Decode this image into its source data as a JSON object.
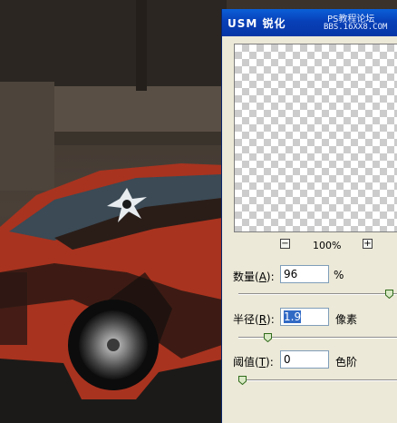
{
  "dialog": {
    "title": "USM 锐化",
    "watermark": {
      "line1": "PS教程论坛",
      "line2": "BBS.16XX8.COM"
    },
    "zoom": {
      "minus_label": "−",
      "plus_label": "+",
      "value": "100%"
    },
    "amount": {
      "label": "数量(",
      "mnemonic": "A",
      "label_end": "):",
      "value": "96",
      "unit": "%",
      "slider_fraction": 0.97
    },
    "radius": {
      "label": "半径(",
      "mnemonic": "R",
      "label_end": "):",
      "value": "1.9",
      "unit": "像素",
      "slider_fraction": 0.17
    },
    "threshold": {
      "label": "阈值(",
      "mnemonic": "T",
      "label_end": "):",
      "value": "0",
      "unit": "色阶",
      "slider_fraction": 0.0
    }
  },
  "colors": {
    "titlebar": "#0840b8",
    "dialog_bg": "#ece9d8",
    "selection": "#316ac5",
    "car_body": "#b83a22"
  }
}
